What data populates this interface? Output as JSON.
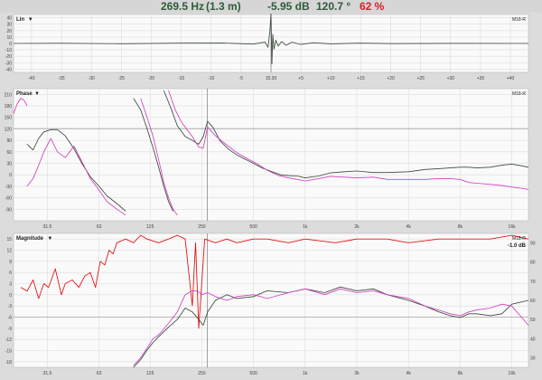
{
  "header": {
    "frequency": "269.5 Hz",
    "distance": "(1.3 m)",
    "level": "-5.95 dB",
    "phase": "120.7 °",
    "percent": "62 %"
  },
  "colors": {
    "dark_trace": "#3a4a3a",
    "pink_trace": "#d040c0",
    "red_trace": "#e01818",
    "panel_bg": "#fafafa",
    "grid": "#dcdcdc",
    "cursor": "#8c8c8c"
  },
  "panels": {
    "lin": {
      "title": "Lin",
      "channel": "M18-R",
      "cursor_label": "15.30"
    },
    "phase": {
      "title": "Phase",
      "channel": "M18-R"
    },
    "magnitude": {
      "title": "Magnitude",
      "channel": "M18-R",
      "readout": "-1.0 dB"
    }
  },
  "chart_data": [
    {
      "type": "line",
      "panel": "lin",
      "title": "Lin",
      "yticks": [
        "40",
        "30",
        "20",
        "10",
        "0",
        "-10",
        "-20",
        "-30",
        "-40"
      ],
      "ylim": [
        -45,
        45
      ],
      "xticks": [
        "-40",
        "-35",
        "-30",
        "-25",
        "-20",
        "-15",
        "-10",
        "-5",
        "15.30",
        "+5",
        "+10",
        "+15",
        "+20",
        "+25",
        "+30",
        "+35",
        "+40"
      ],
      "xlim": [
        -43,
        43
      ],
      "cursor_x": 0,
      "grid": true,
      "series": [
        {
          "color": "dark",
          "x": [
            -43,
            -35,
            -25,
            -15,
            -8,
            -3,
            -1,
            -0.5,
            -0.2,
            0,
            0.15,
            0.3,
            0.5,
            0.8,
            1.2,
            1.8,
            2.5,
            3.5,
            5,
            7,
            10,
            15,
            20,
            30,
            43
          ],
          "y": [
            0,
            0.3,
            -0.4,
            0.4,
            0.6,
            -1,
            2,
            -6,
            18,
            46,
            -32,
            14,
            -9,
            5,
            -4,
            3,
            -3,
            2,
            -1.5,
            1,
            -0.6,
            0.4,
            -0.3,
            0.2,
            0
          ]
        }
      ]
    },
    {
      "type": "line",
      "panel": "phase",
      "title": "Phase",
      "yticks": [
        "210",
        "180",
        "150",
        "120",
        "90",
        "60",
        "30",
        "0",
        "-30",
        "-60",
        "-90"
      ],
      "ylim": [
        -120,
        225
      ],
      "xticks": [
        "31.5",
        "63",
        "125",
        "250",
        "500",
        "1k",
        "2k",
        "4k",
        "8k",
        "16k"
      ],
      "xlim": [
        20,
        20000
      ],
      "log_x": true,
      "cursor_x": 269.5,
      "hline_y": 120.7,
      "grid": true,
      "series": [
        {
          "color": "dark",
          "segments": [
            {
              "x": [
                24,
                26,
                28,
                30,
                33,
                36,
                40,
                45,
                50,
                56
              ],
              "y": [
                80,
                65,
                95,
                112,
                118,
                118,
                102,
                68,
                30,
                -5
              ]
            },
            {
              "x": [
                56,
                63,
                70,
                80,
                90
              ],
              "y": [
                -5,
                -30,
                -55,
                -75,
                -95
              ]
            },
            {
              "x": [
                100,
                110,
                120,
                130,
                140,
                150,
                160,
                170
              ],
              "y": [
                200,
                170,
                120,
                70,
                20,
                -30,
                -70,
                -95
              ]
            },
            {
              "x": [
                150,
                165,
                180,
                200,
                220,
                240,
                255,
                270,
                290,
                320,
                360,
                400,
                450,
                500,
                560,
                640,
                720,
                800,
                900,
                1000,
                1200,
                1400,
                1700,
                2000,
                2500,
                3000,
                4000,
                5000,
                6000,
                7000,
                8000,
                9000,
                10000,
                12000,
                14000,
                16000,
                18000,
                20000
              ],
              "y": [
                220,
                175,
                128,
                100,
                90,
                80,
                100,
                140,
                124,
                88,
                66,
                52,
                40,
                30,
                18,
                8,
                0,
                -2,
                -3,
                -8,
                -3,
                5,
                8,
                10,
                6,
                6,
                8,
                14,
                16,
                18,
                20,
                20,
                18,
                20,
                25,
                28,
                24,
                20
              ]
            }
          ]
        },
        {
          "color": "pink",
          "segments": [
            {
              "x": [
                20,
                21,
                22,
                23,
                24
              ],
              "y": [
                160,
                185,
                200,
                195,
                180
              ]
            },
            {
              "x": [
                24,
                26,
                28,
                30,
                33,
                36,
                40,
                45,
                50,
                56,
                63,
                70,
                80,
                90
              ],
              "y": [
                -30,
                -10,
                25,
                60,
                95,
                60,
                45,
                75,
                35,
                -10,
                -40,
                -70,
                -90,
                -105
              ]
            },
            {
              "x": [
                110,
                120,
                130,
                140,
                150,
                160,
                170,
                180
              ],
              "y": [
                200,
                150,
                100,
                40,
                -20,
                -60,
                -90,
                -105
              ]
            },
            {
              "x": [
                160,
                175,
                190,
                205,
                220,
                240,
                255,
                270,
                300,
                340,
                400,
                460,
                520,
                600,
                700,
                800,
                900,
                1000,
                1200,
                1400,
                1700,
                2000,
                2500,
                3000,
                4000,
                5000,
                6000,
                7000,
                8000,
                9000,
                10000,
                12000,
                14000,
                16000,
                18000,
                20000
              ],
              "y": [
                220,
                170,
                138,
                118,
                100,
                72,
                70,
                125,
                102,
                82,
                58,
                42,
                30,
                12,
                -2,
                -8,
                -12,
                -16,
                -10,
                -4,
                -6,
                -8,
                -6,
                -12,
                -12,
                -12,
                -10,
                -10,
                -12,
                -20,
                -22,
                -25,
                -28,
                -32,
                -35,
                -38
              ]
            }
          ]
        }
      ]
    },
    {
      "type": "line",
      "panel": "magnitude",
      "title": "Magnitude",
      "yticks": [
        "15",
        "12",
        "9",
        "6",
        "3",
        "0",
        "-3",
        "-6",
        "-9",
        "-12",
        "-15",
        "-18"
      ],
      "ylim": [
        -19.5,
        16.5
      ],
      "y2ticks": [
        "90",
        "80",
        "70",
        "60",
        "50",
        "40",
        "30"
      ],
      "y2lim": [
        25,
        95
      ],
      "xticks": [
        "31.5",
        "63",
        "125",
        "250",
        "500",
        "1k",
        "2k",
        "4k",
        "8k",
        "16k"
      ],
      "xlim": [
        20,
        20000
      ],
      "log_x": true,
      "cursor_x": 269.5,
      "hline_y": -5.95,
      "grid": true,
      "series": [
        {
          "color": "red",
          "axis": "left",
          "x": [
            22,
            24,
            26,
            28,
            30,
            32,
            35,
            38,
            40,
            44,
            48,
            52,
            56,
            60,
            64,
            68,
            72,
            76,
            80,
            90,
            100,
            110,
            120,
            140,
            160,
            180,
            200,
            220,
            230,
            240,
            260,
            300,
            350,
            400,
            500,
            600,
            800,
            1000,
            1500,
            2000,
            3000,
            4000,
            6000,
            8000,
            12000,
            16000,
            20000
          ],
          "y": [
            2,
            1,
            4,
            -1,
            3,
            2,
            7,
            0,
            3,
            4,
            2,
            5,
            6,
            2,
            9,
            8,
            12,
            11,
            14,
            15,
            14,
            16,
            15,
            14,
            15,
            16,
            15,
            -3,
            14,
            -9,
            15,
            14,
            15,
            14,
            15,
            15,
            14,
            15,
            14,
            15,
            15,
            14,
            15,
            15,
            15,
            16,
            15
          ]
        },
        {
          "color": "dark",
          "axis": "right",
          "x": [
            100,
            110,
            120,
            130,
            140,
            160,
            180,
            200,
            220,
            240,
            255,
            270,
            300,
            350,
            400,
            500,
            600,
            800,
            1000,
            1300,
            1600,
            2000,
            2500,
            3000,
            4000,
            5000,
            6000,
            7000,
            8000,
            9000,
            10000,
            12000,
            14000,
            16000,
            20000
          ],
          "y": [
            25,
            29,
            34,
            38,
            41,
            46,
            50,
            56,
            54,
            50,
            47,
            54,
            60,
            63,
            61,
            62,
            65,
            64,
            66,
            64,
            67,
            65,
            66,
            63,
            60,
            57,
            54,
            52,
            51,
            53,
            53,
            52,
            53,
            58,
            60
          ]
        },
        {
          "color": "pink",
          "axis": "right",
          "x": [
            100,
            110,
            120,
            130,
            140,
            160,
            180,
            200,
            220,
            235,
            250,
            270,
            300,
            350,
            400,
            500,
            600,
            800,
            1000,
            1300,
            1600,
            2000,
            2500,
            3000,
            4000,
            5000,
            6000,
            7000,
            8000,
            9000,
            10000,
            12000,
            14000,
            16000,
            20000
          ],
          "y": [
            26,
            30,
            35,
            40,
            42,
            48,
            54,
            63,
            65,
            65,
            63,
            64,
            62,
            60,
            62,
            63,
            61,
            64,
            66,
            63,
            66,
            64,
            65,
            63,
            61,
            57,
            55,
            53,
            52,
            54,
            55,
            56,
            58,
            57,
            47
          ]
        }
      ]
    }
  ]
}
